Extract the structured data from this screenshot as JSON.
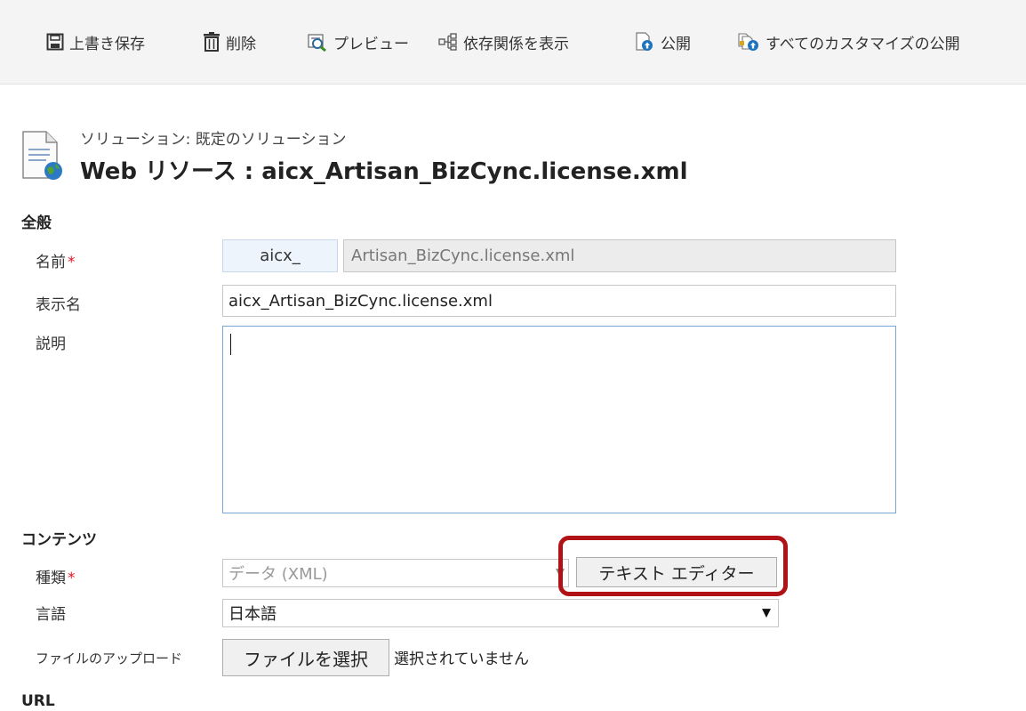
{
  "toolbar": {
    "save": "上書き保存",
    "delete": "削除",
    "preview": "プレビュー",
    "dependencies": "依存関係を表示",
    "publish": "公開",
    "publish_all": "すべてのカスタマイズの公開"
  },
  "header": {
    "solution": "ソリューション: 既定のソリューション",
    "title": "Web リソース : aicx_Artisan_BizCync.license.xml"
  },
  "general": {
    "heading": "全般",
    "name_label": "名前",
    "required_mark": "*",
    "name_prefix": "aicx_",
    "name_value": "Artisan_BizCync.license.xml",
    "display_name_label": "表示名",
    "display_name_value": "aicx_Artisan_BizCync.license.xml",
    "description_label": "説明",
    "description_value": ""
  },
  "content": {
    "heading": "コンテンツ",
    "type_label": "種類",
    "type_value": "データ (XML)",
    "text_editor_button": "テキスト エディター",
    "language_label": "言語",
    "language_value": "日本語",
    "upload_label": "ファイルのアップロード",
    "choose_file_button": "ファイルを選択",
    "no_file_text": "選択されていません"
  },
  "url_section": {
    "heading": "URL"
  },
  "colors": {
    "toolbar_bg": "#f4f4f4",
    "required": "#e81123",
    "highlight": "#b01217",
    "focus_border": "#7aa6d6"
  },
  "icons": [
    "save-icon",
    "trash-icon",
    "preview-icon",
    "dependencies-icon",
    "publish-icon",
    "publish-all-icon",
    "solution-icon"
  ]
}
